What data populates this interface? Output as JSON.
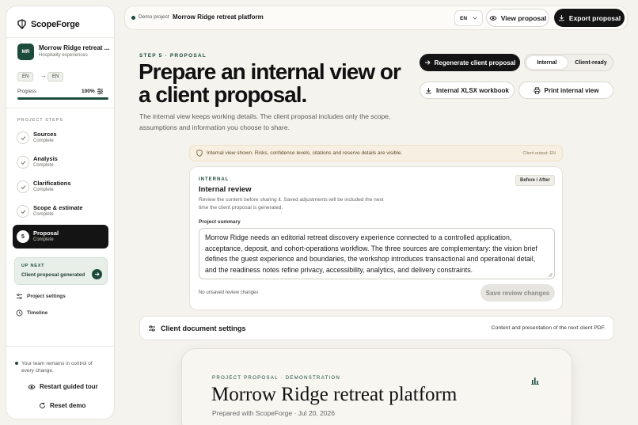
{
  "app": {
    "name": "ScopeForge"
  },
  "project": {
    "initials": "MR",
    "name": "Morrow Ridge retreat ...",
    "category": "Hospitality experiences",
    "lang_from": "EN",
    "lang_arrow": "→",
    "lang_to": "EN",
    "progress_label": "Progress",
    "progress_value": "100%",
    "progress_fraction": 1.0
  },
  "sidebar": {
    "steps_heading": "PROJECT STEPS",
    "steps": [
      {
        "title": "Sources",
        "status": "Complete"
      },
      {
        "title": "Analysis",
        "status": "Complete"
      },
      {
        "title": "Clarifications",
        "status": "Complete"
      },
      {
        "title": "Scope & estimate",
        "status": "Complete"
      },
      {
        "number": "5",
        "title": "Proposal",
        "status": "Complete"
      }
    ],
    "up_next_label": "UP NEXT",
    "up_next_text": "Client proposal generated",
    "links": {
      "settings": "Project settings",
      "timeline": "Timeline"
    },
    "team_note": "Your team remains in control of every change.",
    "restart_tour": "Restart guided tour",
    "reset_demo": "Reset demo"
  },
  "topbar": {
    "demo_label": "Demo project",
    "demo_title": "Morrow Ridge retreat platform",
    "language": "EN",
    "view_proposal": "View proposal",
    "export_proposal": "Export proposal"
  },
  "main": {
    "eyebrow": "STEP 5 · PROPOSAL",
    "title": "Prepare an internal view or a client proposal.",
    "lead": "The internal view keeps working details. The client proposal includes only the scope, assumptions and information you choose to share.",
    "regenerate": "Regenerate client proposal",
    "view_internal": "Internal",
    "view_client": "Client-ready",
    "xlsx": "Internal XLSX workbook",
    "print": "Print internal view"
  },
  "notice": {
    "text": "Internal view shown. Risks, confidence levels, citations and reserve details are visible.",
    "right": "Client output: EN"
  },
  "review": {
    "eyebrow": "INTERNAL",
    "title": "Internal review",
    "description": "Review the content before sharing it. Saved adjustments will be included the next time the client proposal is generated.",
    "badge": "Before / After",
    "summary_label": "Project summary",
    "summary": "Morrow Ridge needs an editorial retreat discovery experience connected to a controlled application, acceptance, deposit, and cohort-operations workflow. The three sources are complementary: the vision brief defines the guest experience and boundaries, the workshop introduces transactional and operational detail, and the readiness notes refine privacy, accessibility, analytics, and delivery constraints.",
    "unsaved": "No unsaved review changes",
    "save": "Save review changes"
  },
  "doc_settings": {
    "title": "Client document settings",
    "description": "Content and presentation of the next client PDF."
  },
  "preview": {
    "eyebrow": "PROJECT PROPOSAL · DEMONSTRATION",
    "title": "Morrow Ridge retreat platform",
    "subtitle": "Prepared with ScopeForge · Jul 20, 2026"
  },
  "colors": {
    "brand": "#1d4b3c",
    "dark": "#141414",
    "background": "#f4f3ee",
    "notice": "#f7f0e2"
  },
  "icons": {
    "brand": "forge-logo-icon",
    "check": "check-icon",
    "sliders": "sliders-icon",
    "clock": "clock-icon",
    "eye": "eye-icon",
    "download": "download-icon",
    "arrow": "arrow-right-icon",
    "printer": "printer-icon",
    "shield": "shield-icon",
    "refresh": "refresh-icon"
  }
}
